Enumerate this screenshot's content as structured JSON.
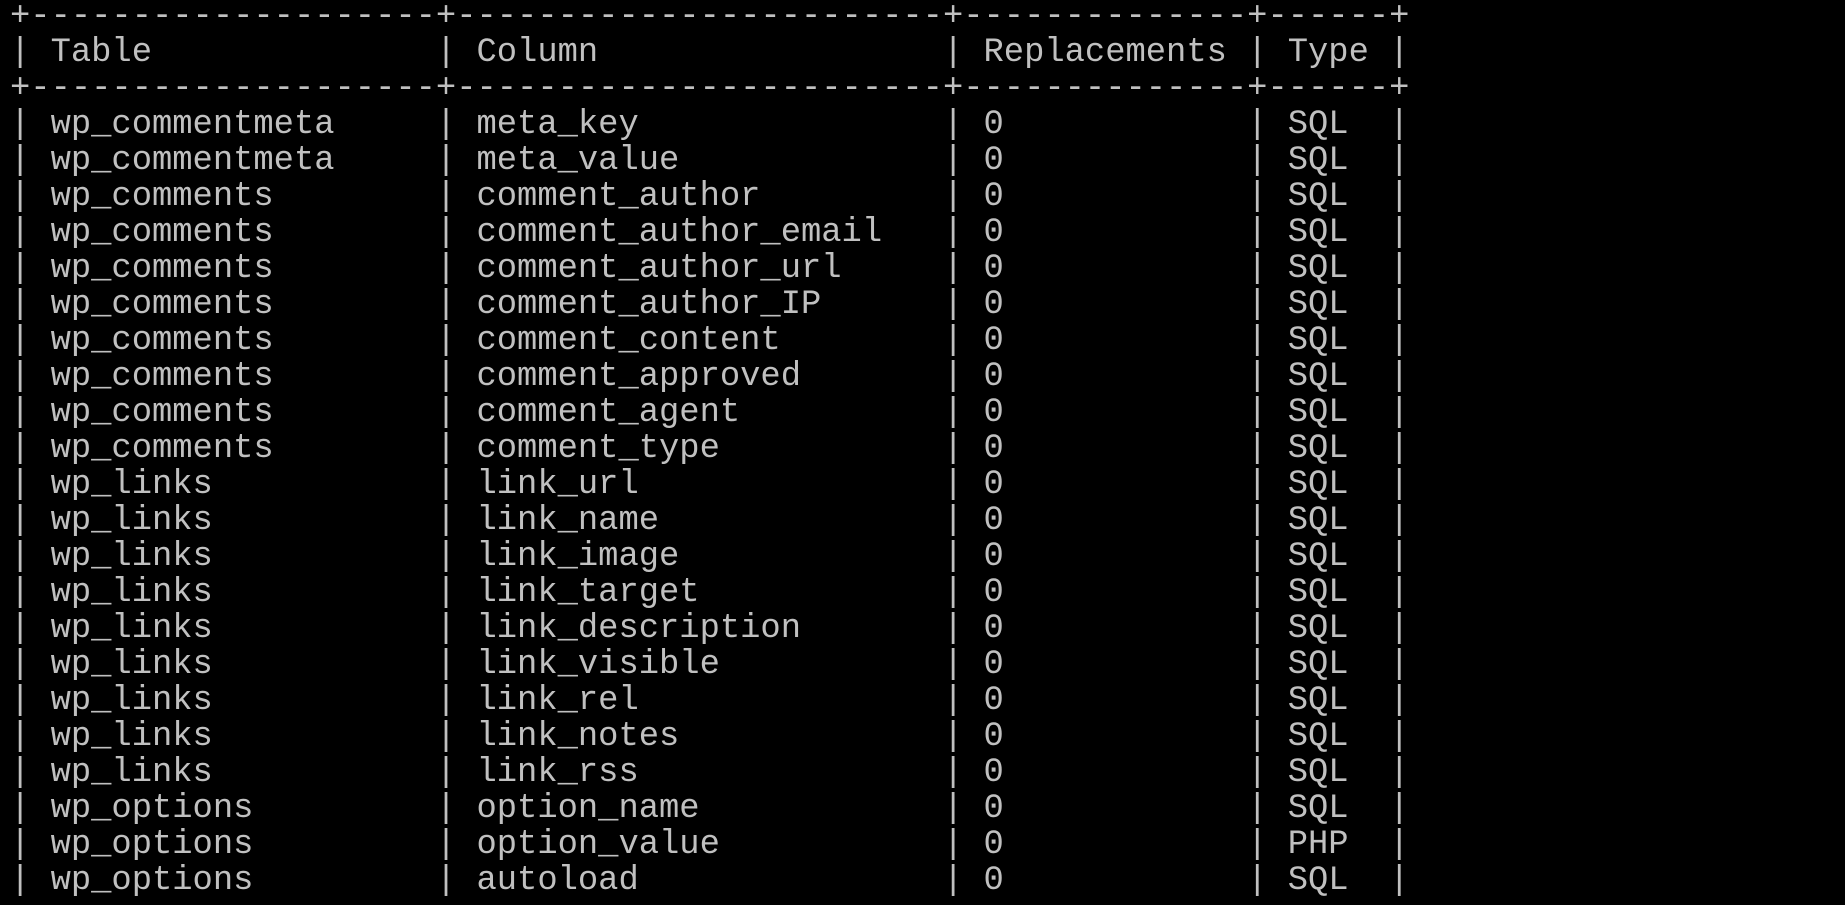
{
  "terminal": {
    "widths": [
      18,
      22,
      12,
      4
    ],
    "headers": [
      "Table",
      "Column",
      "Replacements",
      "Type"
    ],
    "rows": [
      [
        "wp_commentmeta",
        "meta_key",
        "0",
        "SQL"
      ],
      [
        "wp_commentmeta",
        "meta_value",
        "0",
        "SQL"
      ],
      [
        "wp_comments",
        "comment_author",
        "0",
        "SQL"
      ],
      [
        "wp_comments",
        "comment_author_email",
        "0",
        "SQL"
      ],
      [
        "wp_comments",
        "comment_author_url",
        "0",
        "SQL"
      ],
      [
        "wp_comments",
        "comment_author_IP",
        "0",
        "SQL"
      ],
      [
        "wp_comments",
        "comment_content",
        "0",
        "SQL"
      ],
      [
        "wp_comments",
        "comment_approved",
        "0",
        "SQL"
      ],
      [
        "wp_comments",
        "comment_agent",
        "0",
        "SQL"
      ],
      [
        "wp_comments",
        "comment_type",
        "0",
        "SQL"
      ],
      [
        "wp_links",
        "link_url",
        "0",
        "SQL"
      ],
      [
        "wp_links",
        "link_name",
        "0",
        "SQL"
      ],
      [
        "wp_links",
        "link_image",
        "0",
        "SQL"
      ],
      [
        "wp_links",
        "link_target",
        "0",
        "SQL"
      ],
      [
        "wp_links",
        "link_description",
        "0",
        "SQL"
      ],
      [
        "wp_links",
        "link_visible",
        "0",
        "SQL"
      ],
      [
        "wp_links",
        "link_rel",
        "0",
        "SQL"
      ],
      [
        "wp_links",
        "link_notes",
        "0",
        "SQL"
      ],
      [
        "wp_links",
        "link_rss",
        "0",
        "SQL"
      ],
      [
        "wp_options",
        "option_name",
        "0",
        "SQL"
      ],
      [
        "wp_options",
        "option_value",
        "0",
        "PHP"
      ],
      [
        "wp_options",
        "autoload",
        "0",
        "SQL"
      ]
    ]
  }
}
